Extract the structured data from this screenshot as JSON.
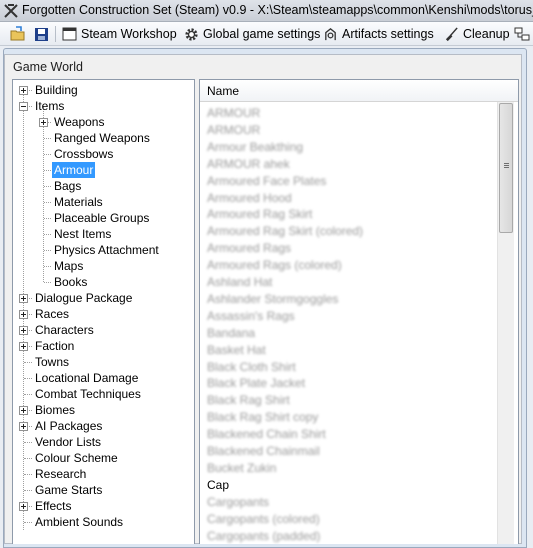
{
  "window": {
    "title": "Forgotten Construction Set (Steam) v0.9 - X:\\Steam\\steamapps\\common\\Kenshi\\mods\\torus_tut"
  },
  "toolbar": {
    "steam_workshop": "Steam Workshop",
    "global_settings": "Global game settings",
    "artifacts_settings": "Artifacts settings",
    "cleanup": "Cleanup"
  },
  "group": {
    "title": "Game World"
  },
  "tree": {
    "items": [
      {
        "label": "Building",
        "expander": "plus"
      },
      {
        "label": "Items",
        "expander": "minus"
      },
      {
        "label": "Weapons",
        "expander": "plus"
      },
      {
        "label": "Ranged Weapons"
      },
      {
        "label": "Crossbows"
      },
      {
        "label": "Armour",
        "selected": true
      },
      {
        "label": "Bags"
      },
      {
        "label": "Materials"
      },
      {
        "label": "Placeable Groups"
      },
      {
        "label": "Nest Items"
      },
      {
        "label": "Physics Attachment"
      },
      {
        "label": "Maps"
      },
      {
        "label": "Books"
      },
      {
        "label": "Dialogue Package",
        "expander": "plus"
      },
      {
        "label": "Races",
        "expander": "plus"
      },
      {
        "label": "Characters",
        "expander": "plus"
      },
      {
        "label": "Faction",
        "expander": "plus"
      },
      {
        "label": "Towns"
      },
      {
        "label": "Locational Damage"
      },
      {
        "label": "Combat Techniques"
      },
      {
        "label": "Biomes",
        "expander": "plus"
      },
      {
        "label": "AI Packages",
        "expander": "plus"
      },
      {
        "label": "Vendor Lists"
      },
      {
        "label": "Colour Scheme"
      },
      {
        "label": "Research"
      },
      {
        "label": "Game Starts"
      },
      {
        "label": "Effects",
        "expander": "plus"
      },
      {
        "label": "Ambient Sounds"
      }
    ]
  },
  "list": {
    "column": "Name",
    "rows": [
      {
        "text": "ARMOUR",
        "blurred": true
      },
      {
        "text": "ARMOUR",
        "blurred": true
      },
      {
        "text": "Armour Beakthing",
        "blurred": true
      },
      {
        "text": "ARMOUR ahek",
        "blurred": true
      },
      {
        "text": "Armoured Face Plates",
        "blurred": true
      },
      {
        "text": "Armoured Hood",
        "blurred": true
      },
      {
        "text": "Armoured Rag Skirt",
        "blurred": true
      },
      {
        "text": "Armoured Rag Skirt (colored)",
        "blurred": true
      },
      {
        "text": "Armoured Rags",
        "blurred": true
      },
      {
        "text": "Armoured Rags (colored)",
        "blurred": true
      },
      {
        "text": "Ashland Hat",
        "blurred": true
      },
      {
        "text": "Ashlander Stormgoggles",
        "blurred": true
      },
      {
        "text": "Assassin's Rags",
        "blurred": true
      },
      {
        "text": "Bandana",
        "blurred": true
      },
      {
        "text": "Basket Hat",
        "blurred": true
      },
      {
        "text": "Black Cloth Shirt",
        "blurred": true
      },
      {
        "text": "Black Plate Jacket",
        "blurred": true
      },
      {
        "text": "Black Rag Shirt",
        "blurred": true
      },
      {
        "text": "Black Rag Shirt copy",
        "blurred": true
      },
      {
        "text": "Blackened Chain Shirt",
        "blurred": true
      },
      {
        "text": "Blackened Chainmail",
        "blurred": true
      },
      {
        "text": "Bucket Zukin",
        "blurred": true
      },
      {
        "text": "Cap",
        "blurred": false
      },
      {
        "text": "Cargopants",
        "blurred": true
      },
      {
        "text": "Cargopants (colored)",
        "blurred": true
      },
      {
        "text": "Cargopants (padded)",
        "blurred": true
      }
    ]
  },
  "colors": {
    "selection": "#3399ff",
    "window_frame": "#dce6f2"
  }
}
